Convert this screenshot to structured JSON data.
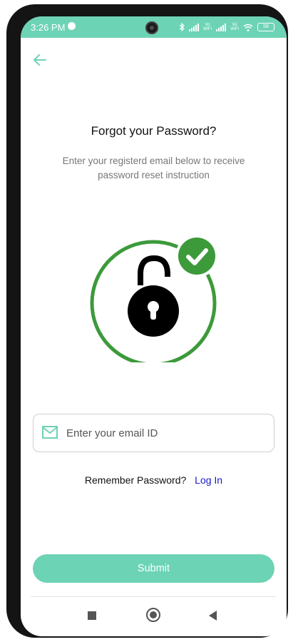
{
  "status_bar": {
    "time": "3:26 PM",
    "network_label_1": "Vo WiFi",
    "network_label_2": "Vo WiFi",
    "battery": "58"
  },
  "header": {
    "back_icon": "arrow-left-icon"
  },
  "main": {
    "title": "Forgot your Password?",
    "subtitle": "Enter your registerd email below to receive password reset instruction",
    "illustration": "padlock-check-icon"
  },
  "form": {
    "email_placeholder": "Enter your email ID",
    "email_value": "",
    "email_icon": "mail-icon"
  },
  "login_prompt": {
    "text": "Remember Password?",
    "link": "Log In"
  },
  "submit_label": "Submit",
  "colors": {
    "accent": "#6dd3b5",
    "success": "#3c9a3a",
    "link": "#1818c8"
  },
  "nav_bar": {
    "icons": [
      "square-icon",
      "home-circle-icon",
      "back-triangle-icon"
    ]
  }
}
